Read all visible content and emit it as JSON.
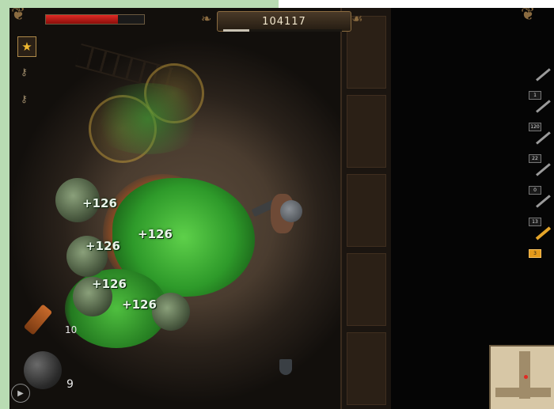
{
  "hud": {
    "health_fraction": 0.73,
    "score": "104117",
    "score_progress_fraction": 0.22,
    "star_icon": "star-icon",
    "inventory_keys": [
      "key-icon",
      "key-icon"
    ]
  },
  "combat": {
    "damage_popups": [
      "+126",
      "+126",
      "+126",
      "+126",
      "+126"
    ]
  },
  "items": {
    "dynamite_count": "10",
    "grenade_count": "9"
  },
  "weapons": [
    {
      "name": "pickaxe",
      "count": "1",
      "selected": false
    },
    {
      "name": "pistol",
      "count": "120",
      "selected": false
    },
    {
      "name": "shotgun",
      "count": "22",
      "selected": false
    },
    {
      "name": "crossbow",
      "count": "0",
      "selected": false
    },
    {
      "name": "flamethrower",
      "count": "13",
      "selected": false
    },
    {
      "name": "golden-rifle",
      "count": "3",
      "selected": true
    }
  ],
  "colors": {
    "health": "#e02a24",
    "acid": "#3fb032",
    "accent": "#e59a1a"
  }
}
